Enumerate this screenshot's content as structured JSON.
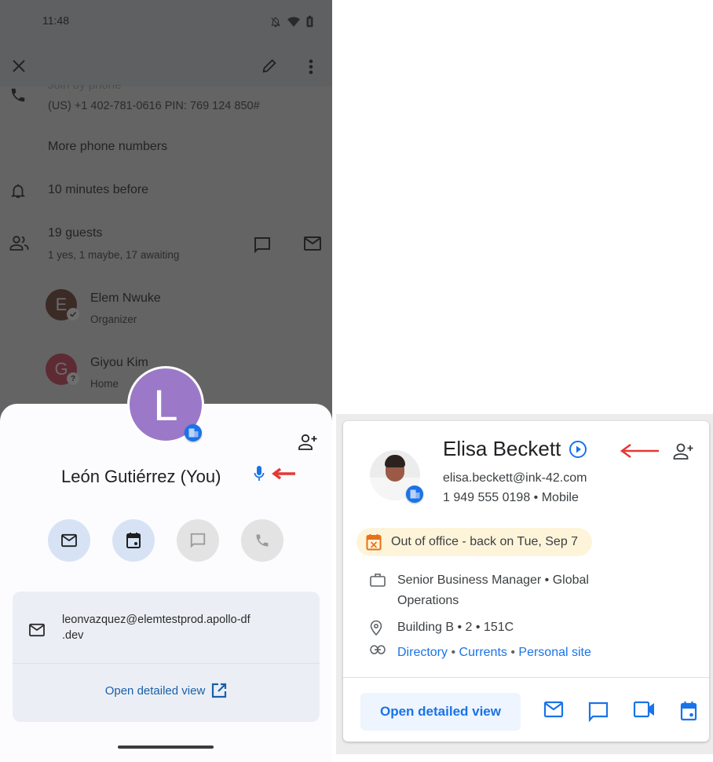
{
  "left_screen": {
    "status_bar": {
      "time": "11:48",
      "icons": [
        "mute-icon",
        "wifi-icon",
        "battery-icon"
      ]
    },
    "app_bar": {
      "close_icon": "close-icon",
      "edit_icon": "pencil-icon",
      "more_icon": "more-vert-icon"
    },
    "event_details": {
      "join_phone": {
        "label": "Join by phone",
        "number": "(US) +1 402-781-0616 PIN: 769 124 850#"
      },
      "more_numbers": "More phone numbers",
      "reminder": "10 minutes before",
      "guests": {
        "title": "19 guests",
        "summary": "1 yes, 1 maybe, 17 awaiting"
      },
      "guest_list": [
        {
          "initial": "E",
          "name": "Elem Nwuke",
          "role": "Organizer",
          "status": "accepted",
          "color": "#3b2b26"
        },
        {
          "initial": "G",
          "name": "Giyou Kim",
          "role": "Home",
          "status": "maybe",
          "color": "#5e2b34"
        }
      ]
    },
    "person_sheet": {
      "avatar_initial": "L",
      "avatar_color": "#9b79c8",
      "name": "León Gutiérrez (You)",
      "actions": [
        {
          "name": "email",
          "enabled": true
        },
        {
          "name": "calendar",
          "enabled": true
        },
        {
          "name": "chat",
          "enabled": false
        },
        {
          "name": "call",
          "enabled": false
        }
      ],
      "email": "leonvazquez@elemtestprod.apollo-df.dev",
      "email_line1": "leonvazquez@elemtestprod.apollo-df",
      "email_line2": ".dev",
      "open_detailed_view": "Open detailed view"
    }
  },
  "right_card": {
    "name": "Elisa Beckett",
    "email": "elisa.beckett@ink-42.com",
    "phone": "1 949 555 0198 • Mobile",
    "out_of_office": "Out of office - back on Tue, Sep 7",
    "job_line1": "Senior Business Manager • Global",
    "job_line2": "Operations",
    "location": "Building B • 2 • 151C",
    "links": [
      "Directory",
      "Currents",
      "Personal site"
    ],
    "link_separator": "•",
    "open_detailed_view": "Open detailed view",
    "actions": [
      "email",
      "chat",
      "video",
      "calendar"
    ]
  },
  "colors": {
    "accent_blue": "#1a73e8",
    "annotation_red": "#e53935",
    "ooo_orange": "#e8711a",
    "ooo_background": "#fef4d9"
  }
}
